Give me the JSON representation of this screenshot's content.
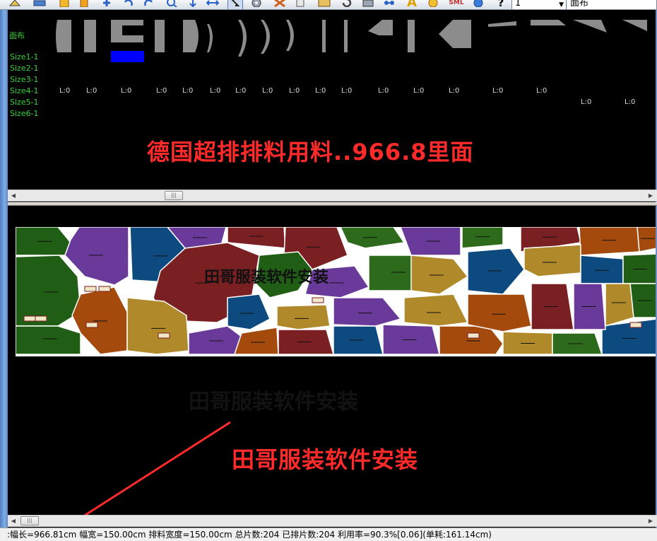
{
  "toolbar": {
    "icons": [
      "measure-icon",
      "ruler-icon",
      "note-icon",
      "mark-icon",
      "piece-add-icon",
      "undo-icon",
      "redo-icon",
      "zoom-icon",
      "arrow-down-icon",
      "flip-icon",
      "select-arrow-icon",
      "reel-icon",
      "grid-icon",
      "copy-icon",
      "image-icon",
      "refresh-icon",
      "tools-icon",
      "connect-icon",
      "text-icon",
      "color-icon",
      "sml-icon",
      "globe-icon",
      "help-icon"
    ],
    "sml_label": "SML",
    "text_icon_label": "A",
    "help_label": "?",
    "size_combo_value": "1",
    "fabric_combo_value": "面布"
  },
  "upper": {
    "fabric_label": "面布",
    "sizes": [
      "Size1-1",
      "Size2-1",
      "Size3-1",
      "Size4-1",
      "Size5-1",
      "Size6-1"
    ],
    "l_labels_row1": [
      "L:0",
      "L:0",
      "L:0",
      "L:0",
      "L:0",
      "L:0",
      "L:0",
      "L:0",
      "L:0",
      "L:0",
      "L:0",
      "L:0",
      "L:0",
      "L:0",
      "L:0"
    ],
    "l_labels_row2": [
      "L:0",
      "L:0"
    ],
    "overlay_text": "德国超排排料用料..966.8里面"
  },
  "marker": {
    "piece_colors": [
      "#1f5e14",
      "#6a3a9a",
      "#0d4a80",
      "#7a1f22",
      "#a34a0c",
      "#b08a2a",
      "#2e6a1c",
      "#7c2a2a"
    ],
    "overlay_text": "田哥服装软件安装"
  },
  "lower": {
    "watermark_text": "田哥服装软件安装"
  },
  "status": {
    "text": ":幅长=966.81cm 幅宽=150.00cm 排料宽度=150.00cm 总片数:204 已排片数:204   利用率=90.3%[0.06](单耗:161.14cm)"
  }
}
